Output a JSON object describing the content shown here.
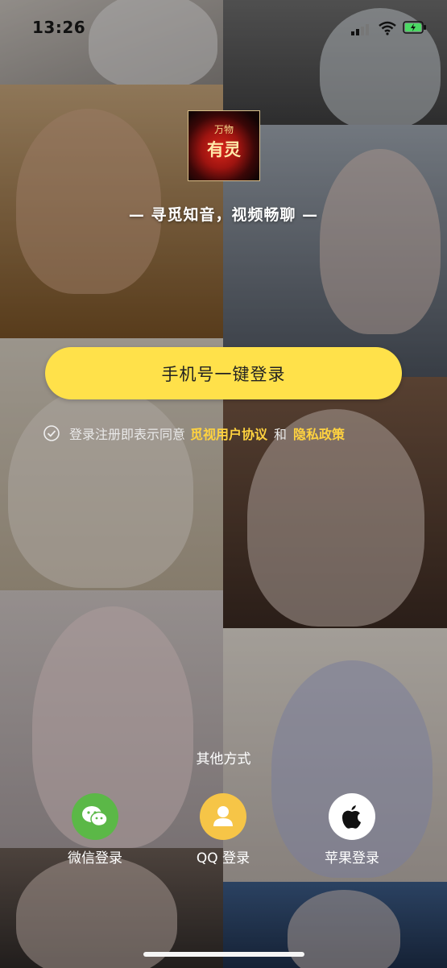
{
  "status_bar": {
    "time": "13:26"
  },
  "brand": {
    "logo_small": "万物",
    "logo_big": "有灵"
  },
  "slogan": "— 寻觅知音，视频畅聊 —",
  "login_button": "手机号一键登录",
  "agreement": {
    "prefix": "登录注册即表示同意",
    "user_agreement": "觅视用户协议",
    "and": "和",
    "privacy_policy": "隐私政策"
  },
  "other_methods": {
    "title": "其他方式",
    "wechat": "微信登录",
    "qq": "QQ 登录",
    "apple": "苹果登录"
  },
  "colors": {
    "accent": "#ffe14a",
    "link": "#ffd23f",
    "wechat": "#5bb847",
    "qq": "#f6c547",
    "apple": "#ffffff"
  },
  "icons": [
    "signal-icon",
    "wifi-icon",
    "battery-icon",
    "checkmark-icon",
    "wechat-icon",
    "qq-icon",
    "apple-icon"
  ]
}
